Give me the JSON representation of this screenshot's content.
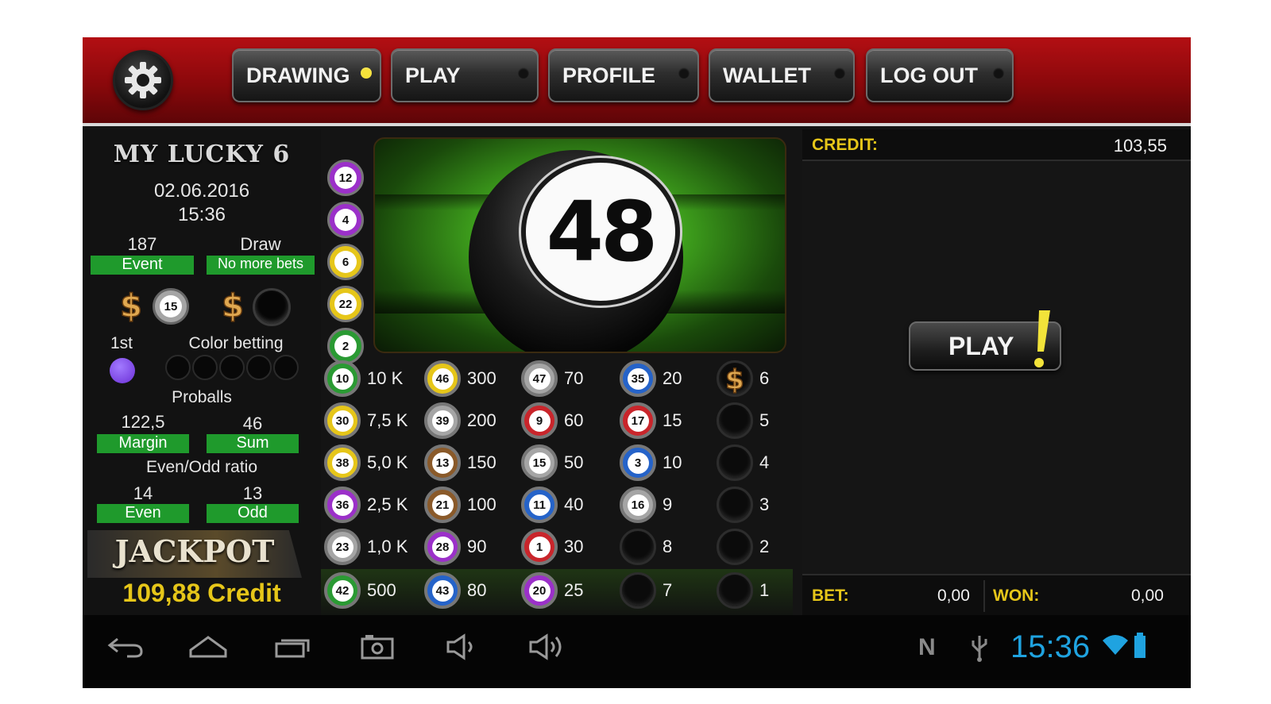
{
  "nav": {
    "buttons": [
      {
        "label": "DRAWING",
        "active": true
      },
      {
        "label": "PLAY",
        "active": false
      },
      {
        "label": "PROFILE",
        "active": false
      },
      {
        "label": "WALLET",
        "active": false
      },
      {
        "label": "LOG OUT",
        "active": false
      }
    ]
  },
  "info": {
    "game_title": "MY LUCKY 6",
    "date": "02.06.2016",
    "time": "15:36",
    "event_value": "187",
    "event_label": "Event",
    "draw_value": "Draw",
    "draw_label": "No more bets",
    "ball_first": "15",
    "first_label": "1st",
    "color_label": "Color betting",
    "proballs_label": "Proballs",
    "margin_value": "122,5",
    "margin_label": "Margin",
    "sum_value": "46",
    "sum_label": "Sum",
    "evenodd_label": "Even/Odd ratio",
    "even_value": "14",
    "even_label": "Even",
    "odd_value": "13",
    "odd_label": "Odd",
    "jackpot_label": "JACKPOT",
    "jackpot_value": "109,88 Credit"
  },
  "drawn_column": [
    {
      "number": "12",
      "color": "#9b30c9"
    },
    {
      "number": "4",
      "color": "#9b30c9"
    },
    {
      "number": "6",
      "color": "#e6c619"
    },
    {
      "number": "22",
      "color": "#e6c619"
    },
    {
      "number": "2",
      "color": "#2a9a33"
    }
  ],
  "current_ball": "48",
  "grid": {
    "col1": [
      {
        "number": "10",
        "value": "10 K",
        "color": "#2a9a33"
      },
      {
        "number": "30",
        "value": "7,5 K",
        "color": "#e6c619"
      },
      {
        "number": "38",
        "value": "5,0 K",
        "color": "#e6c619"
      },
      {
        "number": "36",
        "value": "2,5 K",
        "color": "#9b30c9"
      },
      {
        "number": "23",
        "value": "1,0 K",
        "color": "#a5a5a5"
      },
      {
        "number": "42",
        "value": "500",
        "color": "#2a9a33"
      }
    ],
    "col2": [
      {
        "number": "46",
        "value": "300",
        "color": "#e6c619"
      },
      {
        "number": "39",
        "value": "200",
        "color": "#a5a5a5"
      },
      {
        "number": "13",
        "value": "150",
        "color": "#8a5a2a"
      },
      {
        "number": "21",
        "value": "100",
        "color": "#8a5a2a"
      },
      {
        "number": "28",
        "value": "90",
        "color": "#9b30c9"
      },
      {
        "number": "43",
        "value": "80",
        "color": "#2563c9"
      }
    ],
    "col3": [
      {
        "number": "47",
        "value": "70",
        "color": "#a5a5a5"
      },
      {
        "number": "9",
        "value": "60",
        "color": "#c9252b"
      },
      {
        "number": "15",
        "value": "50",
        "color": "#a5a5a5"
      },
      {
        "number": "11",
        "value": "40",
        "color": "#2563c9"
      },
      {
        "number": "1",
        "value": "30",
        "color": "#c9252b"
      },
      {
        "number": "20",
        "value": "25",
        "color": "#9b30c9"
      }
    ],
    "col4": [
      {
        "number": "35",
        "value": "20",
        "color": "#2563c9"
      },
      {
        "number": "17",
        "value": "15",
        "color": "#c9252b"
      },
      {
        "number": "3",
        "value": "10",
        "color": "#2563c9"
      },
      {
        "number": "16",
        "value": "9",
        "color": "#a5a5a5"
      },
      {
        "number": "",
        "value": "8",
        "color": ""
      },
      {
        "number": "",
        "value": "7",
        "color": ""
      }
    ],
    "col5": [
      {
        "number": "",
        "value": "6",
        "color": "dollar"
      },
      {
        "number": "",
        "value": "5",
        "color": ""
      },
      {
        "number": "",
        "value": "4",
        "color": ""
      },
      {
        "number": "",
        "value": "3",
        "color": ""
      },
      {
        "number": "",
        "value": "2",
        "color": ""
      },
      {
        "number": "",
        "value": "1",
        "color": ""
      }
    ]
  },
  "right": {
    "credit_label": "CREDIT:",
    "credit_value": "103,55",
    "play_label": "PLAY",
    "bet_label": "BET:",
    "bet_value": "0,00",
    "won_label": "WON:",
    "won_value": "0,00"
  },
  "status": {
    "clock": "15:36",
    "nfc_label": "N"
  },
  "colors": {
    "header_red": "#a30d11",
    "green_label": "#1f9a2c",
    "credit_yellow": "#e6c619",
    "clock_blue": "#1fa3e0"
  }
}
